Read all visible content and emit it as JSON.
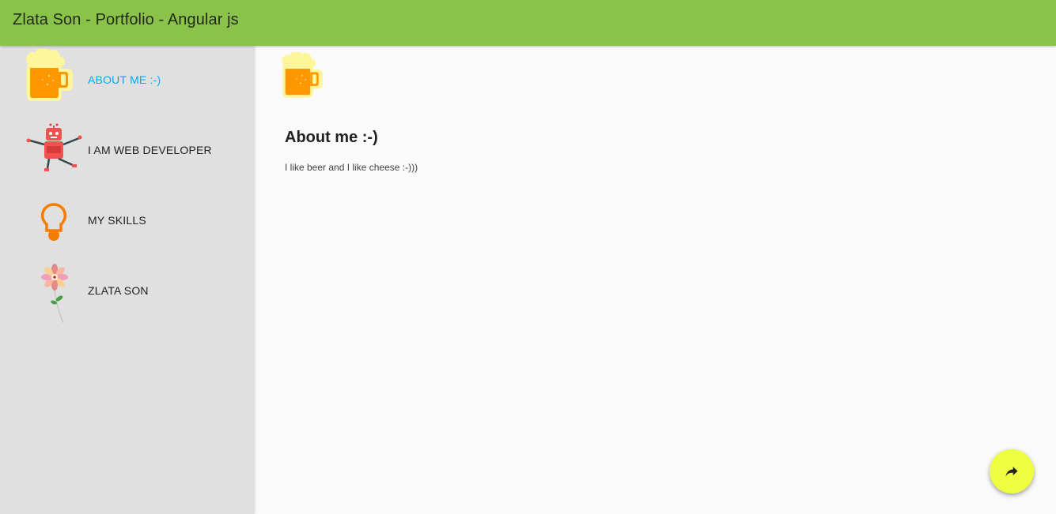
{
  "app": {
    "title": "Zlata Son - Portfolio - Angular js",
    "accent_color": "#8bc34a",
    "active_color": "#03a9f4",
    "fab_color": "#eeff41"
  },
  "sidebar": {
    "items": [
      {
        "label": "ABOUT ME :-)",
        "icon": "beer-mug-icon",
        "active": true
      },
      {
        "label": "I AM WEB DEVELOPER",
        "icon": "robot-icon",
        "active": false
      },
      {
        "label": "MY SKILLS",
        "icon": "light-bulb-icon",
        "active": false
      },
      {
        "label": "ZLATA SON",
        "icon": "flower-icon",
        "active": false
      }
    ]
  },
  "main": {
    "icon": "beer-mug-icon",
    "heading": "About me :-)",
    "text": "I like beer and I like cheese :-)))"
  },
  "fab": {
    "icon": "share-icon"
  }
}
